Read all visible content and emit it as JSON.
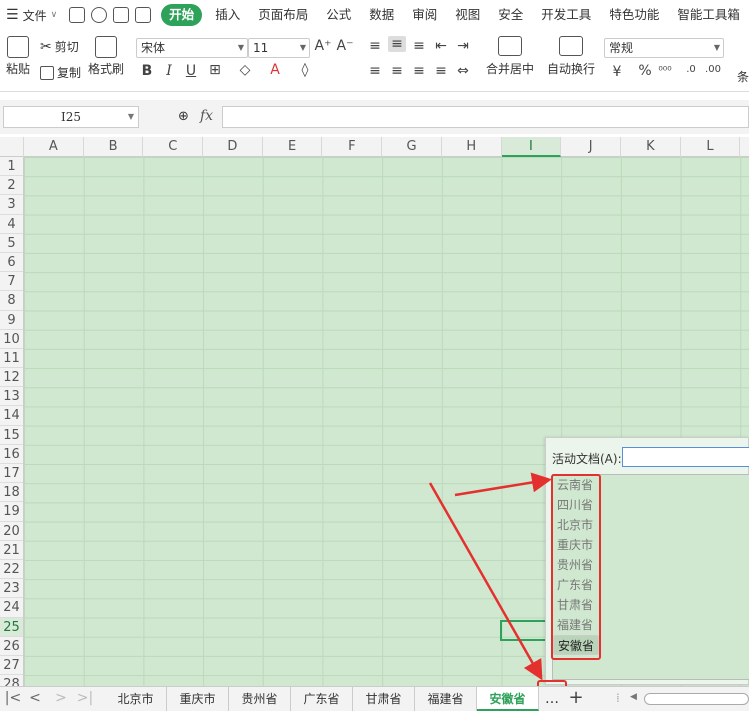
{
  "menu": {
    "file_label": "文件",
    "tabs": [
      "开始",
      "插入",
      "页面布局",
      "公式",
      "数据",
      "审阅",
      "视图",
      "安全",
      "开发工具",
      "特色功能",
      "智能工具箱"
    ],
    "active_tab": "开始"
  },
  "ribbon": {
    "paste": "粘贴",
    "cut": "剪切",
    "copy": "复制",
    "format_painter": "格式刷",
    "font_name": "宋体",
    "font_size": "11",
    "merge_center": "合并居中",
    "wrap_text": "自动换行",
    "number_format": "常规",
    "cond_partial": "条"
  },
  "formula_bar": {
    "cell_ref": "I25",
    "fx": "fx",
    "value": ""
  },
  "columns": [
    "A",
    "B",
    "C",
    "D",
    "E",
    "F",
    "G",
    "H",
    "I",
    "J",
    "K",
    "L"
  ],
  "active_column": "I",
  "rows": [
    "1",
    "2",
    "3",
    "4",
    "5",
    "6",
    "7",
    "8",
    "9",
    "10",
    "11",
    "12",
    "13",
    "14",
    "15",
    "16",
    "17",
    "18",
    "19",
    "20",
    "21",
    "22",
    "23",
    "24",
    "25",
    "26",
    "27",
    "28"
  ],
  "active_row": "25",
  "popup": {
    "label": "活动文档(A):",
    "items": [
      "云南省",
      "四川省",
      "北京市",
      "重庆市",
      "贵州省",
      "广东省",
      "甘肃省",
      "福建省",
      "安徽省"
    ],
    "selected": "安徽省"
  },
  "sheet_tabs": [
    "北京市",
    "重庆市",
    "贵州省",
    "广东省",
    "甘肃省",
    "福建省",
    "安徽省"
  ],
  "active_sheet": "安徽省",
  "more_label": "…",
  "colors": {
    "accent": "#2ea15a",
    "annotation": "#e53030",
    "sheet_bg": "#cfe8cf"
  }
}
